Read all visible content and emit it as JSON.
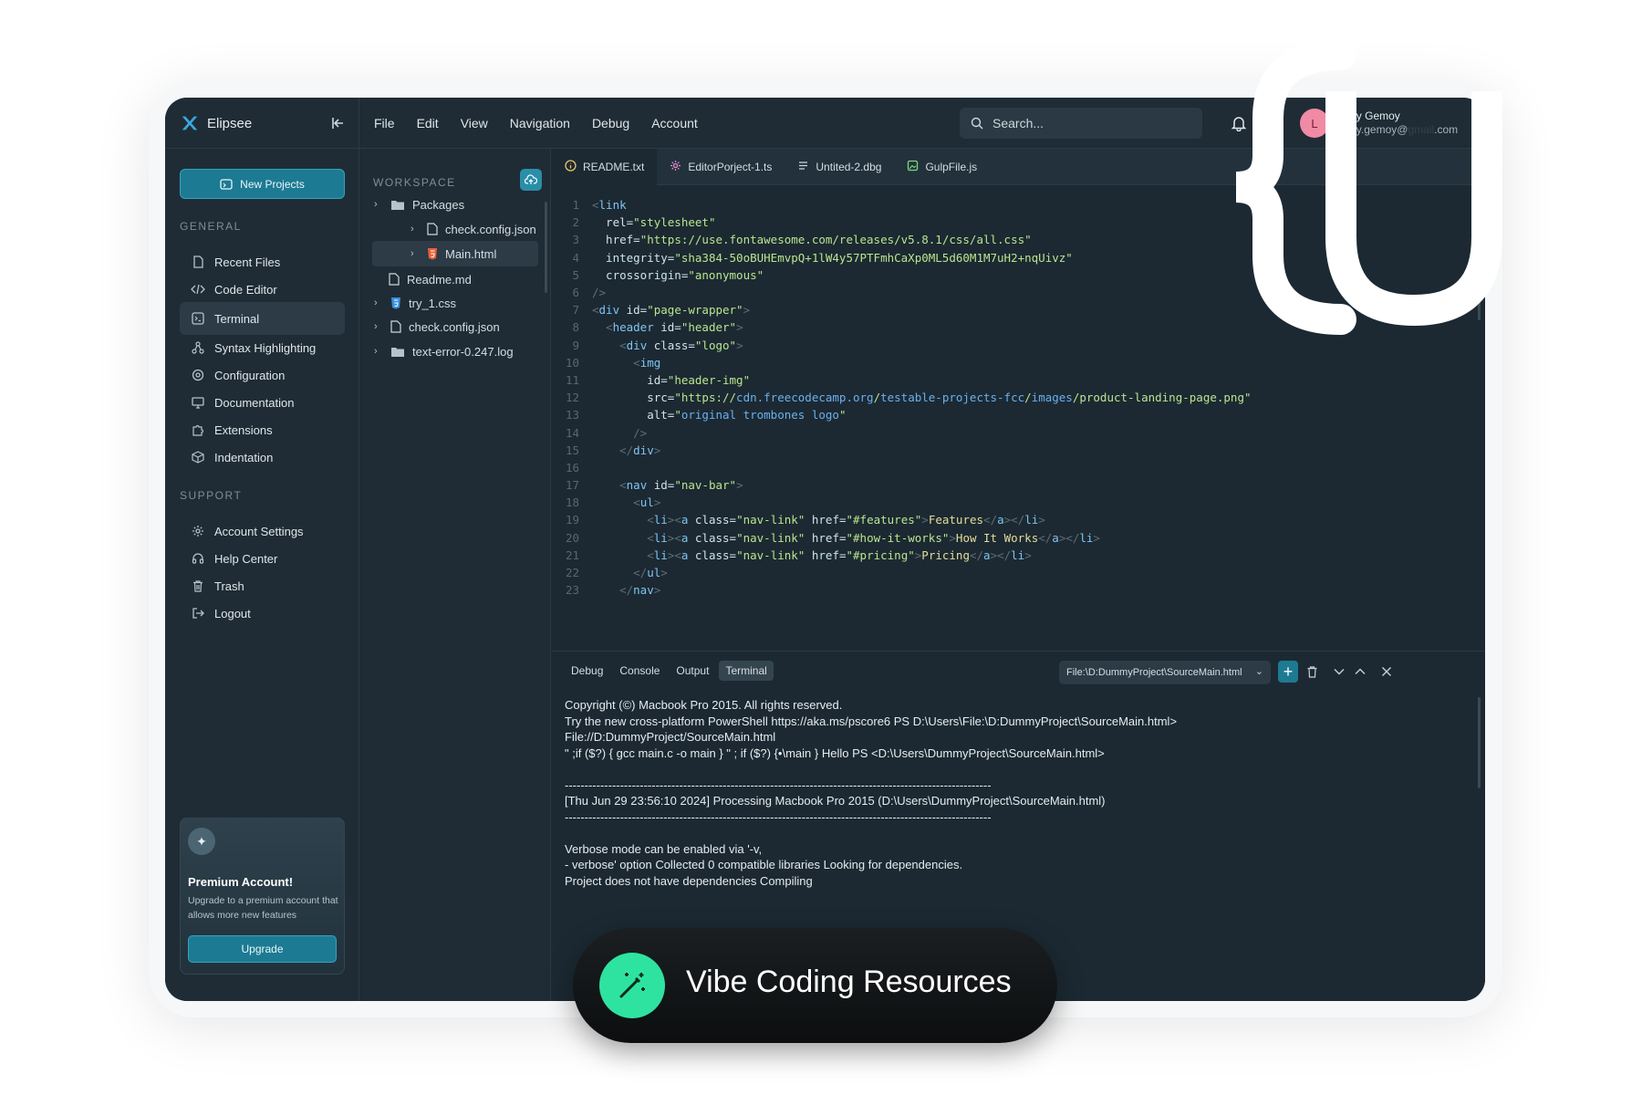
{
  "brand": {
    "name": "Elipsee"
  },
  "menu": [
    "File",
    "Edit",
    "View",
    "Navigation",
    "Debug",
    "Account"
  ],
  "search": {
    "placeholder": "Search..."
  },
  "user": {
    "initial": "L",
    "name": "Luffy Gemoy",
    "email": "Luffy.gemoy@",
    "email_tail": ".com"
  },
  "sidebar": {
    "new_projects": "New Projects",
    "general_title": "GENERAL",
    "general": [
      {
        "label": "Recent Files",
        "icon": "file-icon"
      },
      {
        "label": "Code Editor",
        "icon": "code-icon"
      },
      {
        "label": "Terminal",
        "icon": "terminal-icon"
      },
      {
        "label": "Syntax Highlighting",
        "icon": "nodes-icon"
      },
      {
        "label": "Configuration",
        "icon": "settings-icon"
      },
      {
        "label": "Documentation",
        "icon": "monitor-icon"
      },
      {
        "label": "Extensions",
        "icon": "puzzle-icon"
      },
      {
        "label": "Indentation",
        "icon": "cube-icon"
      }
    ],
    "support_title": "SUPPORT",
    "support": [
      {
        "label": "Account Settings",
        "icon": "gear-icon"
      },
      {
        "label": "Help Center",
        "icon": "headset-icon"
      },
      {
        "label": "Trash",
        "icon": "trash-icon"
      },
      {
        "label": "Logout",
        "icon": "logout-icon"
      }
    ],
    "promo": {
      "title": "Premium Account!",
      "desc": "Upgrade to a premium account that allows more new features",
      "button": "Upgrade"
    }
  },
  "tree": {
    "title": "WORKSPACE",
    "items": [
      {
        "label": "Packages",
        "type": "folder"
      },
      {
        "label": "check.config.json",
        "type": "file"
      },
      {
        "label": "Main.html",
        "type": "html"
      },
      {
        "label": "Readme.md",
        "type": "file"
      },
      {
        "label": "try_1.css",
        "type": "css"
      },
      {
        "label": "check.config.json",
        "type": "file"
      },
      {
        "label": "text-error-0.247.log",
        "type": "folder"
      }
    ]
  },
  "tabs": [
    {
      "label": "README.txt",
      "icon": "info-icon",
      "color": "#e8c36a"
    },
    {
      "label": "EditorPorject-1.ts",
      "icon": "gear-icon",
      "color": "#e78ad0"
    },
    {
      "label": "Untited-2.dbg",
      "icon": "lines-icon",
      "color": "#cfd7dc"
    },
    {
      "label": "GulpFile.js",
      "icon": "image-icon",
      "color": "#7ed67e"
    }
  ],
  "code": [
    "<link",
    "  rel=\"stylesheet\"",
    "  href=\"https://use.fontawesome.com/releases/v5.8.1/css/all.css\"",
    "  integrity=\"sha384-50oBUHEmvpQ+1lW4y57PTFmhCaXp0ML5d60M1M7uH2+nqUivz\"",
    "  crossorigin=\"anonymous\"",
    "/>",
    "<div id=\"page-wrapper\">",
    "  <header id=\"header\">",
    "    <div class=\"logo\">",
    "      <img",
    "        id=\"header-img\"",
    "        src=\"https://cdn.freecodecamp.org/testable-projects-fcc/images/product-landing-page.png\"",
    "        alt=\"original trombones logo\"",
    "      />",
    "    </div>",
    "",
    "    <nav id=\"nav-bar\">",
    "      <ul>",
    "        <li><a class=\"nav-link\" href=\"#features\">Features</a></li>",
    "        <li><a class=\"nav-link\" href=\"#how-it-works\">How It Works</a></li>",
    "        <li><a class=\"nav-link\" href=\"#pricing\">Pricing</a></li>",
    "      </ul>",
    "    </nav>"
  ],
  "panel": {
    "tabs": [
      "Debug",
      "Console",
      "Output",
      "Terminal"
    ],
    "path": "File:\\D:DummyProject\\SourceMain.html",
    "terminal": [
      "Copyright (©) Macbook Pro 2015. All rights reserved.",
      "Try the new cross-platform PowerShell https://aka.ms/pscore6 PS D:\\Users\\File:\\D:DummyProject\\SourceMain.html>",
      "File://D:DummyProject/SourceMain.html",
      "\" ;if ($?) { gcc main.c -o main } \" ; if ($?) {•\\main } Hello PS <D:\\Users\\DummyProject\\SourceMain.html>",
      "",
      "------------------------------------------------------------------------------------------------------------",
      "[Thu Jun 29 23:56:10 2024] Processing Macbook Pro 2015 (D:\\Users\\DummyProject\\SourceMain.html)",
      "------------------------------------------------------------------------------------------------------------",
      "",
      "Verbose mode can be enabled via '-v,",
      "- verbose' option Collected 0 compatible libraries Looking for dependencies.",
      "Project does not have dependencies Compiling"
    ]
  },
  "badge": {
    "label": "Vibe Coding Resources"
  }
}
